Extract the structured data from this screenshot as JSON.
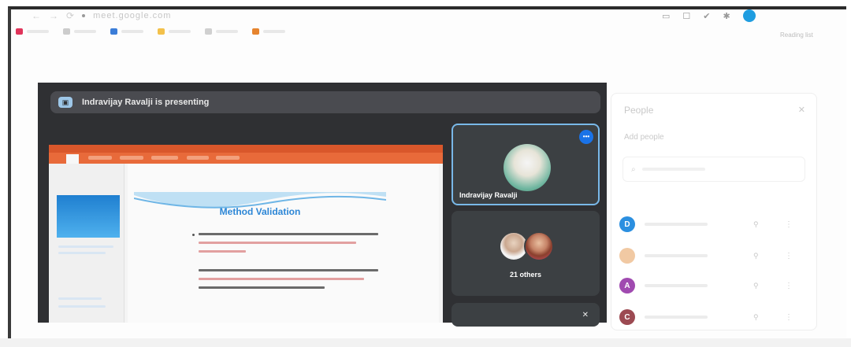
{
  "browser": {
    "url": "meet.google.com",
    "reload_glyph": "⟳",
    "bookmarks": [
      {
        "color": "#e0345a"
      },
      {
        "color": "#cccccc"
      },
      {
        "color": "#3b7dd8"
      },
      {
        "color": "#f3c14b"
      },
      {
        "color": "#d0d0d0"
      },
      {
        "color": "#e6842e"
      }
    ],
    "right_glyphs": {
      "cast": "▭",
      "tab": "☐",
      "check": "✔",
      "puzzle": "✱"
    },
    "reading_list": "Reading list"
  },
  "meet": {
    "presenting_text": "Indravijay Ravalji is presenting",
    "presenting_icon": "present-icon",
    "slide": {
      "title": "Method Validation",
      "ribbon_color": "#e86a3a",
      "title_color": "#2c86d6"
    },
    "tiles": {
      "main_name": "Indravijay Ravalji",
      "main_badge": "•••",
      "others_label": "21 others",
      "mic_glyph": "✕"
    }
  },
  "people_panel": {
    "title": "People",
    "close_glyph": "✕",
    "add_people": "Add people",
    "search_glyph": "⌕",
    "rows": [
      {
        "initial": "D",
        "color": "#2b8fe0"
      },
      {
        "initial": "",
        "color": "#f1c9a3"
      },
      {
        "initial": "A",
        "color": "#a04ab0"
      },
      {
        "initial": "C",
        "color": "#9c4a52"
      }
    ],
    "mute_glyph": "🎙",
    "more_glyph": "⋮",
    "pin_glyph": "⚲"
  }
}
